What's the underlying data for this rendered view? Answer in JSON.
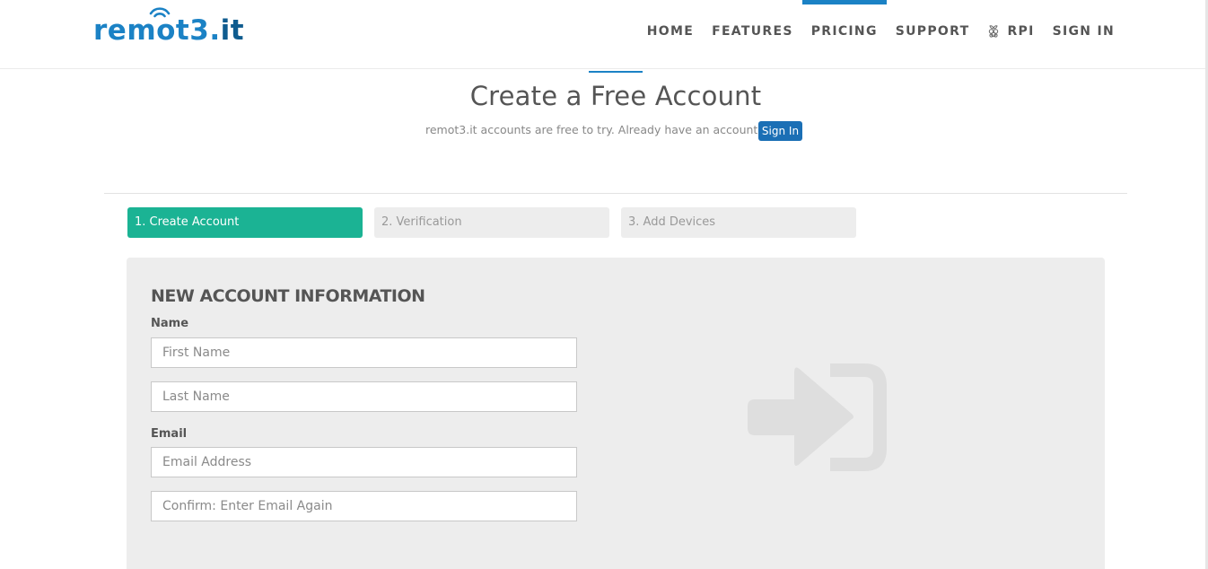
{
  "header": {
    "logo": {
      "main": "remot3",
      "dot": ".",
      "suffix": "it"
    },
    "nav": [
      {
        "label": "HOME"
      },
      {
        "label": "FEATURES"
      },
      {
        "label": "PRICING",
        "active": true
      },
      {
        "label": "SUPPORT"
      },
      {
        "label": "RPI",
        "icon": "raspberry-pi-icon"
      },
      {
        "label": "SIGN IN"
      }
    ]
  },
  "hero": {
    "title": "Create a Free Account",
    "subtitle": "remot3.it accounts are free to try. Already have an account?",
    "signin_button": "Sign In"
  },
  "steps": [
    {
      "label": "1. Create Account",
      "active": true
    },
    {
      "label": "2. Verification",
      "active": false
    },
    {
      "label": "3. Add Devices",
      "active": false
    }
  ],
  "form": {
    "heading": "NEW ACCOUNT INFORMATION",
    "name_label": "Name",
    "first_name_placeholder": "First Name",
    "last_name_placeholder": "Last Name",
    "email_label": "Email",
    "email_placeholder": "Email Address",
    "confirm_email_placeholder": "Confirm: Enter Email Again",
    "side_icon": "sign-in-icon"
  },
  "colors": {
    "brand_blue": "#1b82c5",
    "step_active": "#1bb394",
    "button_blue": "#1b6fb5"
  }
}
